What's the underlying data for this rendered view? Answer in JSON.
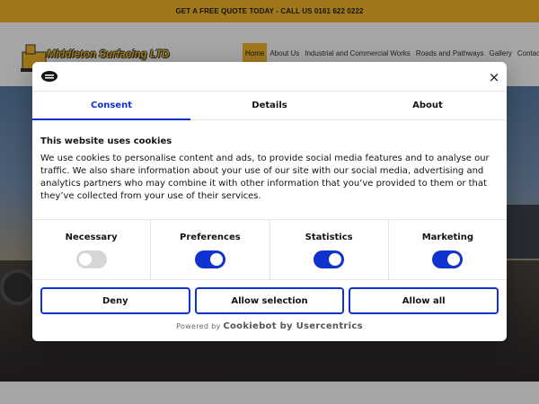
{
  "topbar": {
    "text": "GET A FREE QUOTE TODAY - CALL US 0161 622 0222"
  },
  "header": {
    "logo_text": "Middleton Surfacing LTD",
    "nav": [
      {
        "label": "Home",
        "active": true
      },
      {
        "label": "About Us"
      },
      {
        "label": "Industrial and Commercial Works"
      },
      {
        "label": "Roads and Pathways"
      },
      {
        "label": "Gallery"
      },
      {
        "label": "Contact"
      }
    ]
  },
  "cookie_dialog": {
    "tabs": [
      "Consent",
      "Details",
      "About"
    ],
    "active_tab": "Consent",
    "title": "This website uses cookies",
    "body": "We use cookies to personalise content and ads, to provide social media features and to analyse our traffic. We also share information about your use of our site with our social media, advertising and analytics partners who may combine it with other information that you’ve provided to them or that they’ve collected from your use of their services.",
    "toggles": [
      {
        "label": "Necessary",
        "state": "on-disabled"
      },
      {
        "label": "Preferences",
        "state": "on"
      },
      {
        "label": "Statistics",
        "state": "on"
      },
      {
        "label": "Marketing",
        "state": "on"
      }
    ],
    "buttons": {
      "deny": "Deny",
      "allow_selection": "Allow selection",
      "allow_all": "Allow all"
    },
    "powered_prefix": "Powered by",
    "powered_brand": "Cookiebot by Usercentrics",
    "close_icon": "×"
  },
  "colors": {
    "brand_yellow": "#f6b92b",
    "accent_blue": "#1032cf"
  }
}
